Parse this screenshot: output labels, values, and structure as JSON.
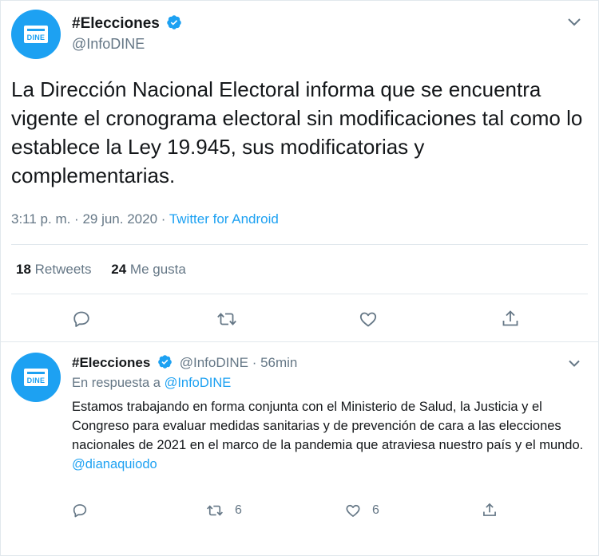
{
  "main_tweet": {
    "display_name": "#Elecciones",
    "handle": "@InfoDINE",
    "avatar_text": "DINE",
    "text": "La Dirección Nacional Electoral informa que se encuentra vigente el cronograma electoral sin modificaciones tal como lo establece la Ley 19.945, sus modificatorias y complementarias.",
    "timestamp": "3:11 p. m. · 29 jun. 2020 · ",
    "source": "Twitter for Android",
    "retweets_count": "18",
    "retweets_label": "Retweets",
    "likes_count": "24",
    "likes_label": "Me gusta"
  },
  "reply_tweet": {
    "display_name": "#Elecciones",
    "handle_time": "@InfoDINE · 56min",
    "avatar_text": "DINE",
    "in_reply_prefix": "En respuesta a ",
    "in_reply_handle": "@InfoDINE",
    "text": "Estamos trabajando en forma conjunta con el Ministerio de Salud, la Justicia y el Congreso para evaluar medidas sanitarias y de prevención de cara a las elecciones nacionales de 2021 en el marco de la pandemia que atraviesa nuestro país y el mundo.",
    "mention": "@dianaquiodo",
    "retweet_count": "6",
    "like_count": "6"
  },
  "colors": {
    "accent": "#1da1f2",
    "text": "#14171a",
    "secondary": "#657786",
    "border": "#e1e8ed"
  },
  "icons": [
    "verified-badge-icon",
    "chevron-down-icon",
    "reply-icon",
    "retweet-icon",
    "like-icon",
    "share-icon"
  ]
}
